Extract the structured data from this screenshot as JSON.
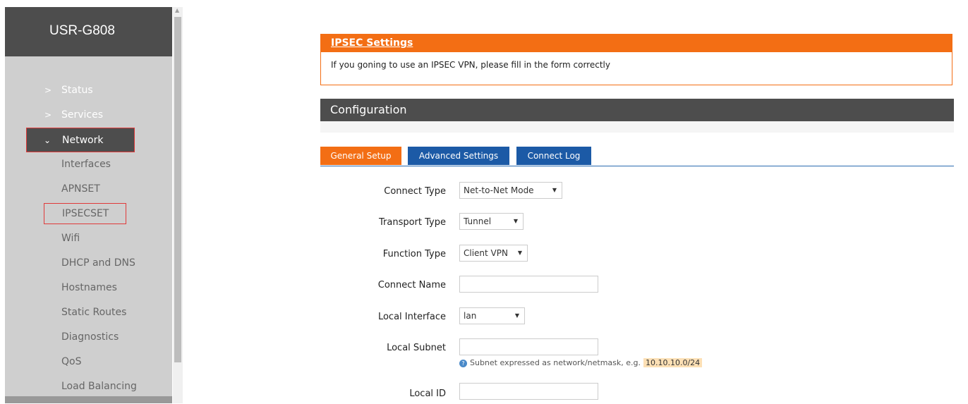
{
  "sidebar": {
    "brand": "USR-G808",
    "top_items": [
      {
        "label": "Status"
      },
      {
        "label": "Services"
      },
      {
        "label": "Network"
      }
    ],
    "sub_items": [
      {
        "label": "Interfaces"
      },
      {
        "label": "APNSET"
      },
      {
        "label": "IPSECSET"
      },
      {
        "label": "Wifi"
      },
      {
        "label": "DHCP and DNS"
      },
      {
        "label": "Hostnames"
      },
      {
        "label": "Static Routes"
      },
      {
        "label": "Diagnostics"
      },
      {
        "label": "QoS"
      },
      {
        "label": "Load Balancing"
      }
    ]
  },
  "ipsec": {
    "title": "IPSEC Settings",
    "description": "If you goning to use an IPSEC VPN, please fill in the form correctly"
  },
  "config": {
    "title": "Configuration"
  },
  "tabs": [
    {
      "label": "General Setup"
    },
    {
      "label": "Advanced Settings"
    },
    {
      "label": "Connect Log"
    }
  ],
  "form": {
    "connect_type": {
      "label": "Connect Type",
      "value": "Net-to-Net Mode"
    },
    "transport_type": {
      "label": "Transport Type",
      "value": "Tunnel"
    },
    "function_type": {
      "label": "Function Type",
      "value": "Client VPN"
    },
    "connect_name": {
      "label": "Connect Name",
      "value": ""
    },
    "local_interface": {
      "label": "Local Interface",
      "value": "lan"
    },
    "local_subnet": {
      "label": "Local Subnet",
      "value": "",
      "hint": "Subnet expressed as network/netmask, e.g.",
      "hint_example": "10.10.10.0/24"
    },
    "local_id": {
      "label": "Local ID",
      "value": ""
    }
  },
  "colors": {
    "accent_orange": "#f36e14",
    "tab_blue": "#1c5aa6",
    "dark_bar": "#4d4d4d",
    "sidebar": "#cfcfcf"
  }
}
